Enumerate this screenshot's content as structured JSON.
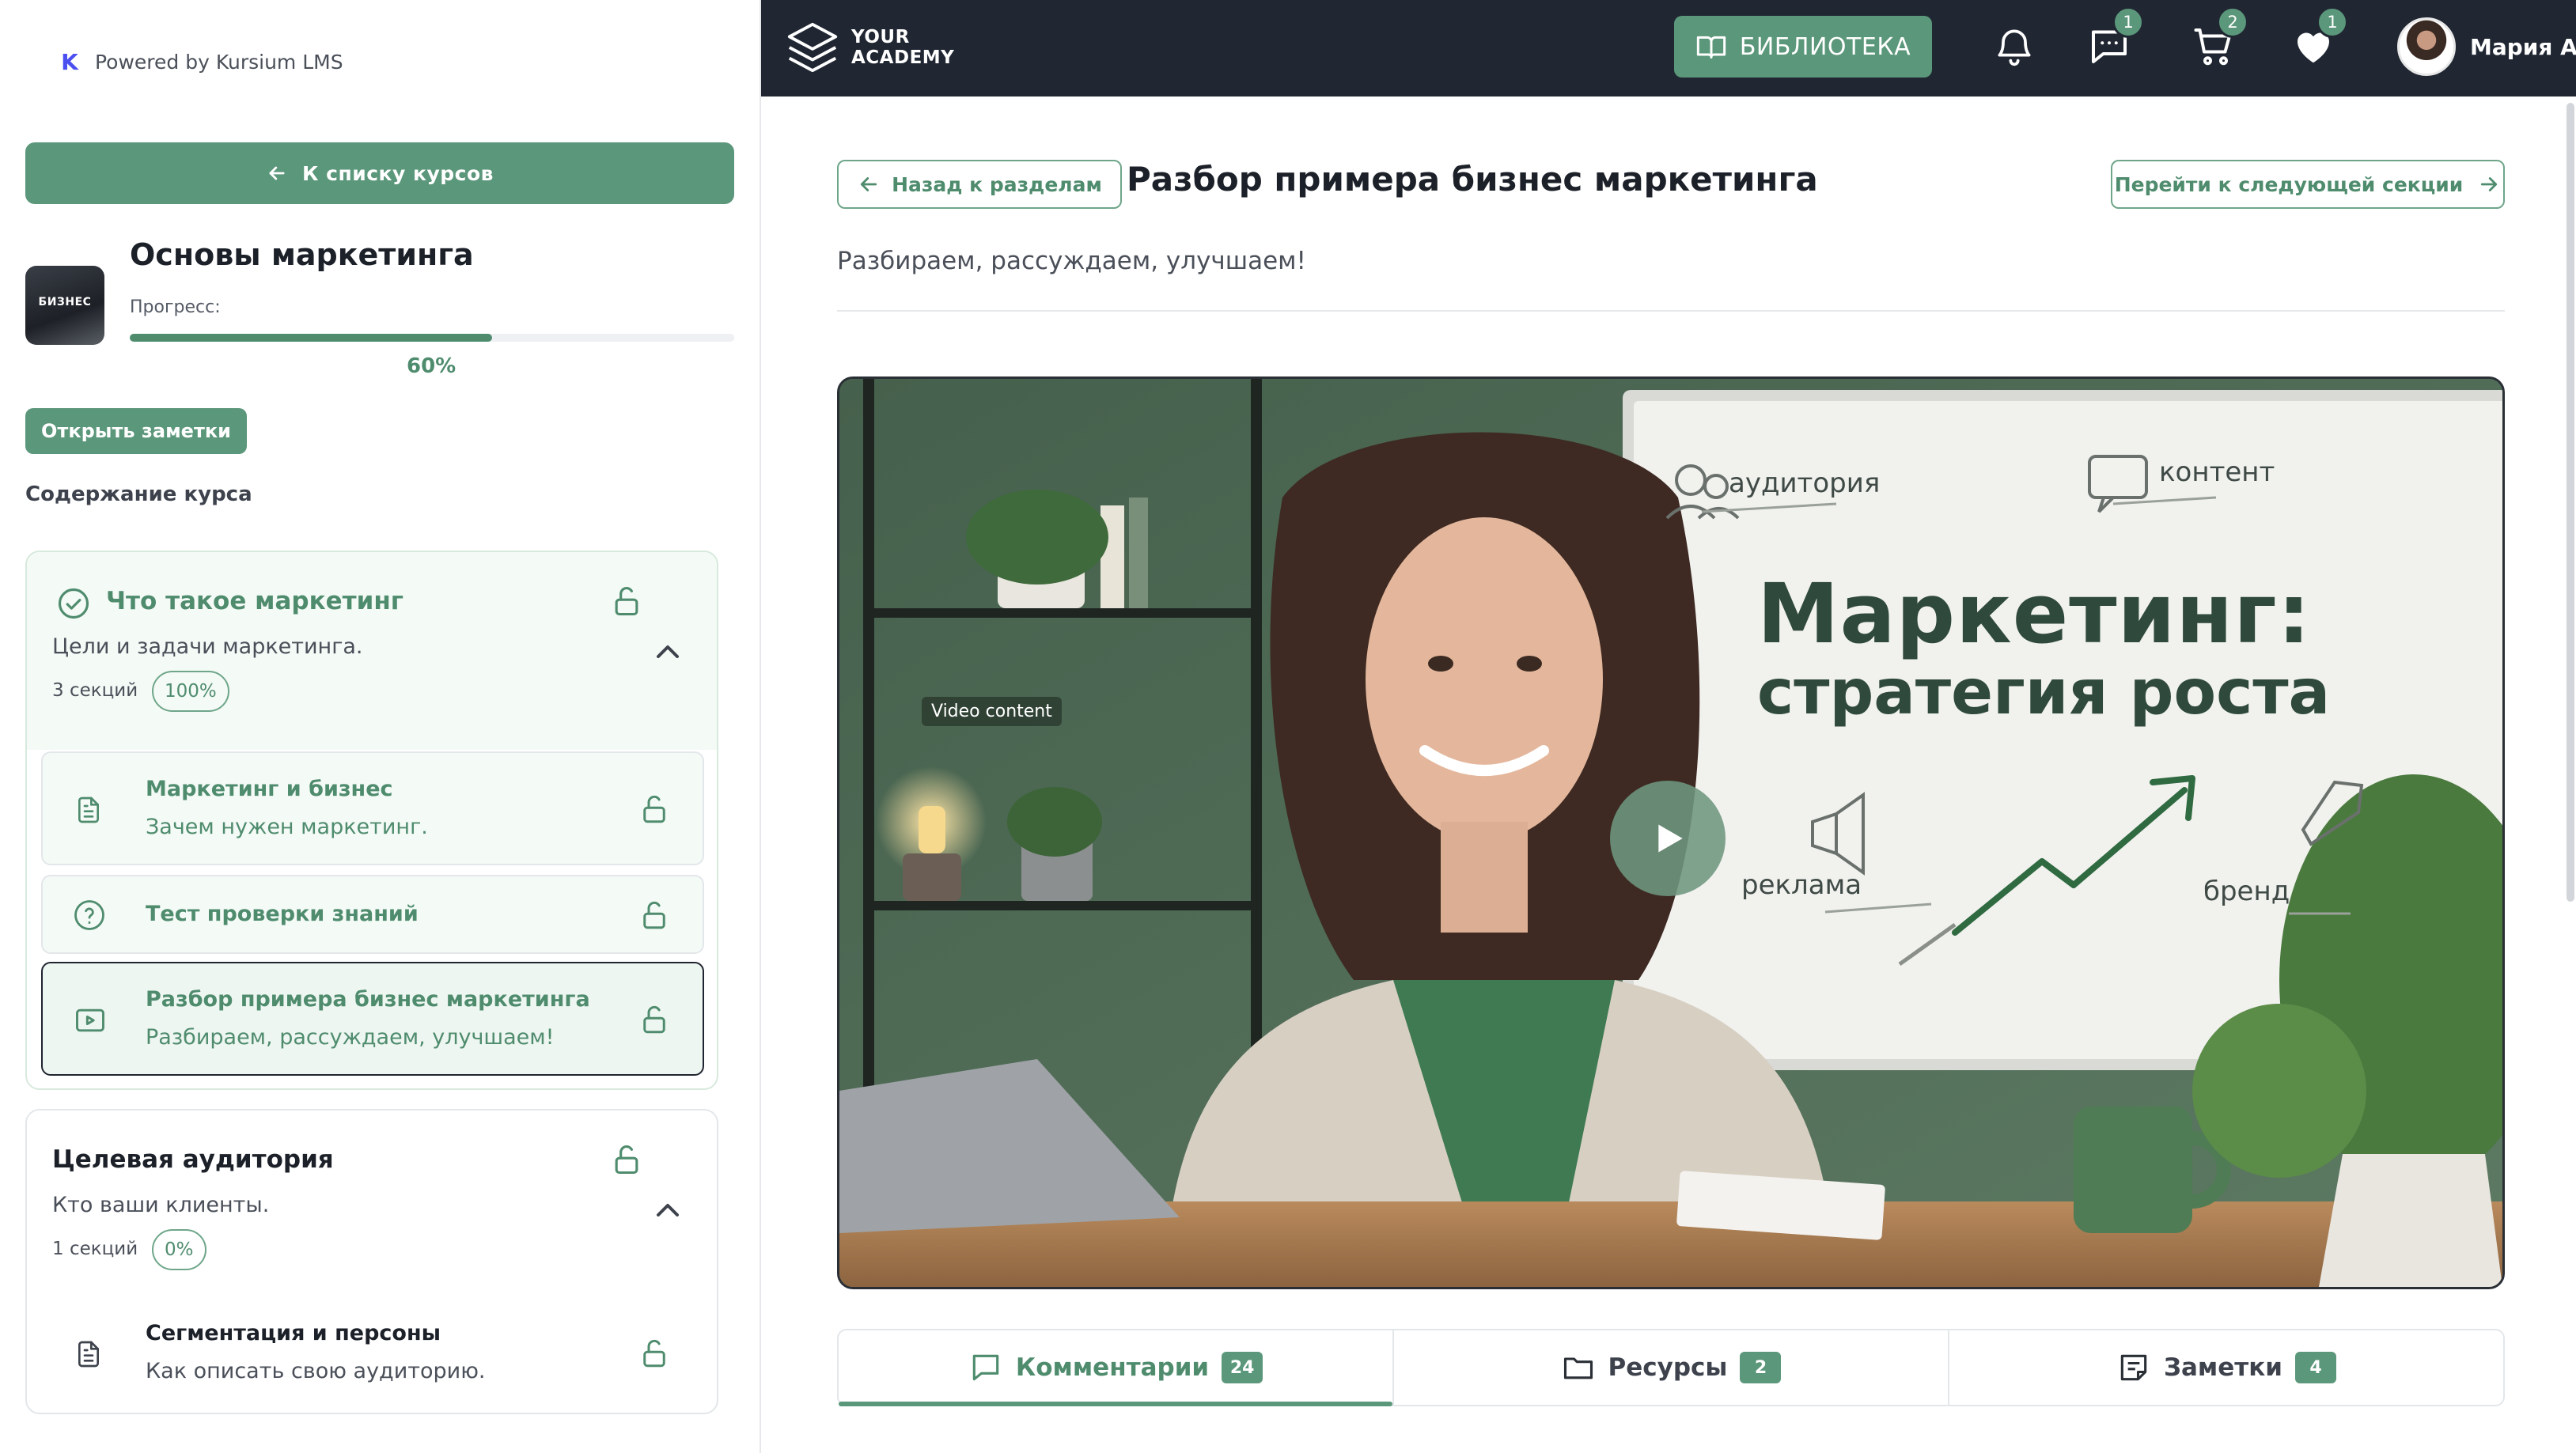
{
  "sidebar": {
    "powered_by": "Powered by Kursium LMS",
    "back_to_courses": "К списку курсов",
    "course": {
      "title": "Основы маркетинга",
      "thumb_label": "БИЗНЕС",
      "progress_label": "Прогресс:",
      "progress_value": 60,
      "progress_text": "60%"
    },
    "notes_button": "Открыть заметки",
    "content_title": "Содержание курса",
    "modules": [
      {
        "name": "Что такое маркетинг",
        "description": "Цели и задачи маркетинга.",
        "sections": "3 секций",
        "percent": "100%",
        "lessons": [
          {
            "name": "Маркетинг и бизнес",
            "description": "Зачем нужен маркетинг.",
            "icon": "document-icon"
          },
          {
            "name": "Тест проверки знаний",
            "description": "",
            "icon": "question-icon"
          },
          {
            "name": "Разбор примера бизнес маркетинга",
            "description": "Разбираем, рассуждаем, улучшаем!",
            "icon": "video-icon"
          }
        ]
      },
      {
        "name": "Целевая аудитория",
        "description": "Кто ваши клиенты.",
        "sections": "1 секций",
        "percent": "0%",
        "lessons": [
          {
            "name": "Сегментация и персоны",
            "description": "Как описать свою аудиторию.",
            "icon": "document-icon"
          }
        ]
      }
    ]
  },
  "topbar": {
    "brand_line1": "YOUR",
    "brand_line2": "ACADEMY",
    "library": "БИБЛИОТЕКА",
    "badges": {
      "messages": "1",
      "cart": "2",
      "favorites": "1"
    },
    "user_name": "Мария А."
  },
  "main": {
    "back_to_section": "Назад к разделам",
    "title": "Разбор примера бизнес маркетинга",
    "next_section": "Перейти к следующей секции",
    "subtitle": "Разбираем, рассуждаем, улучшаем!",
    "video": {
      "chip": "Video content",
      "whiteboard_title": "Маркетинг:",
      "whiteboard_subtitle": "стратегия роста",
      "labels": {
        "audience": "аудитория",
        "content": "контент",
        "ads": "реклама",
        "brand": "бренд"
      }
    },
    "tabs": [
      {
        "label": "Комментарии",
        "count": "24"
      },
      {
        "label": "Ресурсы",
        "count": "2"
      },
      {
        "label": "Заметки",
        "count": "4"
      }
    ]
  },
  "colors": {
    "accent": "#5b977a",
    "accent_text": "#4f8c6e",
    "topbar": "#202733"
  }
}
